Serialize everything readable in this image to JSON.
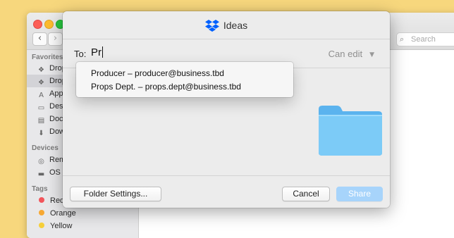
{
  "finder": {
    "search_placeholder": "Search",
    "sidebar": {
      "favorites_header": "Favorites",
      "favorites": [
        {
          "label": "Drop",
          "icon": "dropbox-icon"
        },
        {
          "label": "Drop",
          "icon": "dropbox-icon",
          "selected": true
        },
        {
          "label": "Appl",
          "icon": "applications-icon"
        },
        {
          "label": "Desk",
          "icon": "desktop-icon"
        },
        {
          "label": "Doc",
          "icon": "documents-icon"
        },
        {
          "label": "Dow",
          "icon": "downloads-icon"
        }
      ],
      "devices_header": "Devices",
      "devices": [
        {
          "label": "Rem",
          "icon": "disc-icon"
        },
        {
          "label": "OS X",
          "icon": "hard-drive-icon"
        }
      ],
      "tags_header": "Tags",
      "tags": [
        {
          "label": "Red",
          "color": "#f2555b"
        },
        {
          "label": "Orange",
          "color": "#f7a833"
        },
        {
          "label": "Yellow",
          "color": "#f6cf3a"
        }
      ]
    }
  },
  "sheet": {
    "title": "Ideas",
    "to_label": "To:",
    "to_value": "Pr",
    "permission": "Can edit",
    "suggestions": [
      "Producer – producer@business.tbd",
      "Props Dept. – props.dept@business.tbd"
    ],
    "folder_settings_label": "Folder Settings...",
    "cancel_label": "Cancel",
    "share_label": "Share"
  },
  "colors": {
    "desktop": "#f7d77d",
    "dropbox_blue": "#0061fe",
    "folder_blue": "#6fc0f4",
    "share_button_disabled": "#a7d4fb"
  }
}
